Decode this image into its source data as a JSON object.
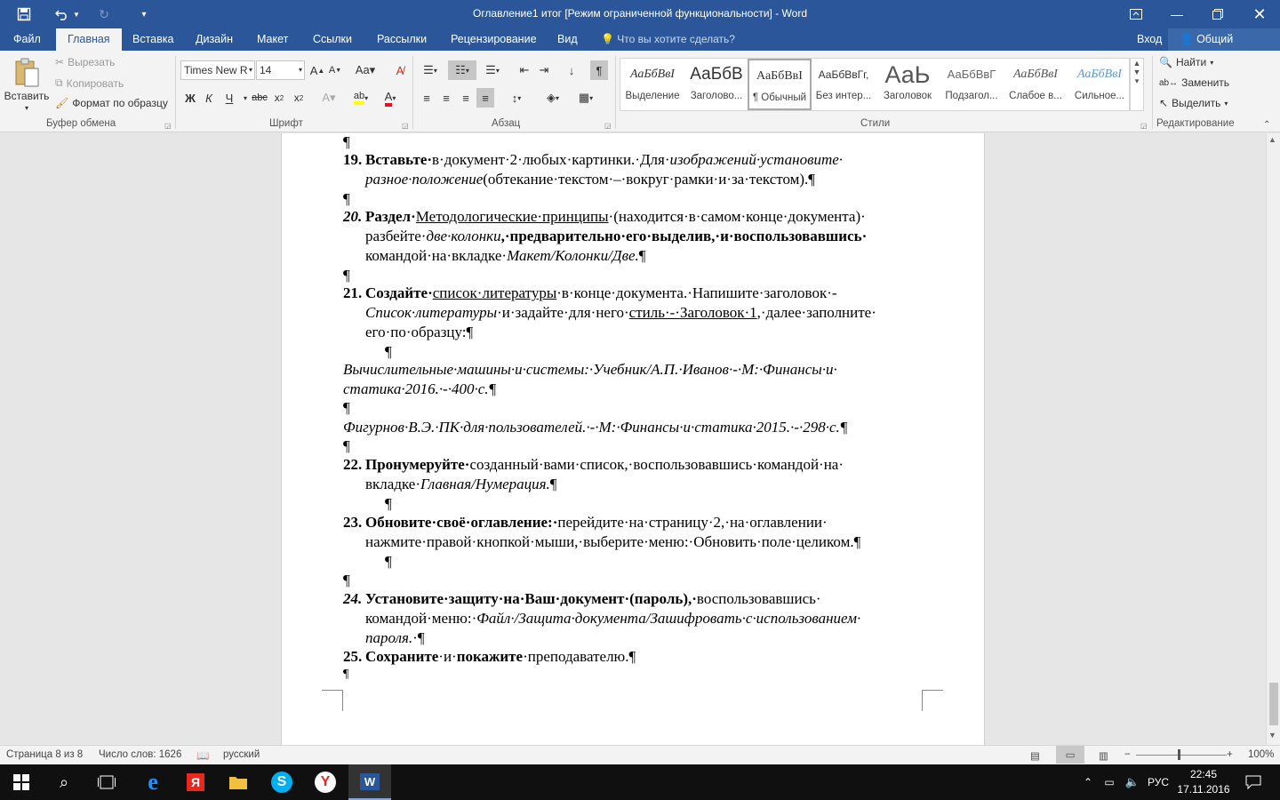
{
  "window": {
    "title": "Оглавление1 итог [Режим ограниченной функциональности] - Word",
    "tabs": [
      "Файл",
      "Главная",
      "Вставка",
      "Дизайн",
      "Макет",
      "Ссылки",
      "Рассылки",
      "Рецензирование",
      "Вид"
    ],
    "active_tab": "Главная",
    "tell_me": "Что вы хотите сделать?",
    "login": "Вход",
    "share": "Общий доступ"
  },
  "ribbon": {
    "clipboard": {
      "label": "Буфер обмена",
      "paste": "Вставить",
      "cut": "Вырезать",
      "copy": "Копировать",
      "format_painter": "Формат по образцу"
    },
    "font": {
      "label": "Шрифт",
      "name": "Times New R",
      "size": "14"
    },
    "paragraph": {
      "label": "Абзац"
    },
    "styles": {
      "label": "Стили",
      "items": [
        {
          "preview": "АаБбВвІ",
          "name": "Выделение"
        },
        {
          "preview": "АаБбВ",
          "name": "Заголово..."
        },
        {
          "preview": "АаБбВвІ",
          "name": "¶ Обычный"
        },
        {
          "preview": "АаБбВвГг,",
          "name": "Без интер..."
        },
        {
          "preview": "АаЬ",
          "name": "Заголовок"
        },
        {
          "preview": "АаБбВвГ",
          "name": "Подзагол..."
        },
        {
          "preview": "АаБбВвІ",
          "name": "Слабое в..."
        },
        {
          "preview": "АаБбВвІ",
          "name": "Сильное..."
        }
      ]
    },
    "editing": {
      "label": "Редактирование",
      "find": "Найти",
      "replace": "Заменить",
      "select": "Выделить"
    }
  },
  "doc": {
    "pilcrow": "¶",
    "i19": {
      "num": "19.",
      "l1_b": "Вставьте·",
      "l1_t": "в·документ·2·любых·картинки.·Для·",
      "l1_i": "изображений·установите·",
      "l2_i": "разное·положение",
      "l2_t": "(обтекание·текстом·–·вокруг·рамки·и·за·текстом).¶"
    },
    "i20": {
      "num": "20.",
      "l1_b": "Раздел·",
      "l1_u": "Методологические·принципы",
      "l1_t": "·(находится·в·самом·конце·документа)·",
      "l2_t": "разбейте·",
      "l2_i": "две·колонки",
      "l2_t2": ",·предварительно·его·выделив,·и·воспользовавшись·",
      "l3_t": "командой·на·вкладке·",
      "l3_i": "Макет/Колонки/Две.",
      "l3_p": "¶"
    },
    "i21": {
      "num": "21.",
      "l1_b": "Создайте·",
      "l1_u": "список·литературы",
      "l1_t": "·в·конце·документа.·Напишите·заголовок·-",
      "l2_i": "Список·литературы",
      "l2_t": "·и·задайте·для·него·",
      "l2_u": "стиль·-·Заголовок·1",
      "l2_t2": ",·далее·заполните·",
      "l3_t": "его·по·образцу:¶"
    },
    "ref1_l1": "Вычислительные·машины·и·системы:·Учебник/А.П.·Иванов·-·М:·Финансы·и·",
    "ref1_l2": "статика·2016.·-·400·с.¶",
    "ref2": "Фигурнов·В.Э.·ПК·для·пользователей.·-·М:·Финансы·и·статика·2015.·-·298·с.¶",
    "i22": {
      "num": "22.",
      "l1_b": "Пронумеруйте·",
      "l1_t": "созданный·вами·список,·воспользовавшись·командой·на·",
      "l2_t": "вкладке·",
      "l2_i": "Главная/Нумерация.",
      "l2_p": "¶"
    },
    "i23": {
      "num": "23.",
      "l1_b": "Обновите·своё·оглавление:·",
      "l1_t": "перейдите·на·страницу·2,·на·оглавлении·",
      "l2_t": "нажмите·правой·кнопкой·мыши,·выберите·меню:·Обновить·поле·целиком.¶"
    },
    "i24": {
      "num": "24.",
      "l1_b": "Установите·защиту·на·Ваш·документ·(пароль),·",
      "l1_t": "воспользовавшись·",
      "l2_t": "командой·меню:·",
      "l2_i": "Файл·/Защита·документа/Зашифровать·с·использованием·",
      "l3_i": "пароля.",
      "l3_t": "·¶"
    },
    "i25": {
      "num": "25.",
      "b1": "Сохраните",
      "t1": "·и·",
      "b2": "покажите",
      "t2": "·преподавателю.¶"
    }
  },
  "status": {
    "page": "Страница 8 из 8",
    "words": "Число слов: 1626",
    "lang": "русский",
    "zoom": "100%"
  },
  "taskbar": {
    "lang": "РУС",
    "time": "22:45",
    "date": "17.11.2016"
  },
  "colors": {
    "accent": "#2b579a",
    "taskbar": "#101010"
  }
}
